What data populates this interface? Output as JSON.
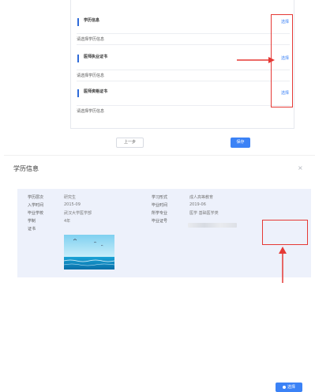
{
  "form": {
    "sections": [
      {
        "title": "学历信息",
        "action": "选择"
      },
      {
        "title": "医师执业证书",
        "action": "选择"
      },
      {
        "title": "医师资格证书",
        "action": "选择"
      }
    ],
    "hint_text": "请选择学历信息",
    "prev_button": "上一步",
    "save_button": "保存"
  },
  "modal": {
    "title": "学历信息",
    "close": "×",
    "fields": {
      "level_label": "学历层次",
      "level_value": "研究生",
      "mode_label": "学习形式",
      "mode_value": "成人高等教育",
      "start_label": "入学时间",
      "start_value": "2015-09",
      "grad_label": "毕业时间",
      "grad_value": "2019-06",
      "school_label": "毕业学校",
      "school_value": "武汉大学医学部",
      "major_label": "所学专业",
      "major_value": "医学 基础医学类",
      "duration_label": "学制",
      "duration_value": "4年",
      "certno_label": "毕业证号",
      "cert_label": "证书"
    },
    "select_button": "选择"
  },
  "colors": {
    "accent": "#3b82f6",
    "annotation_red": "#e53935",
    "panel_bg": "#edf1fb"
  }
}
